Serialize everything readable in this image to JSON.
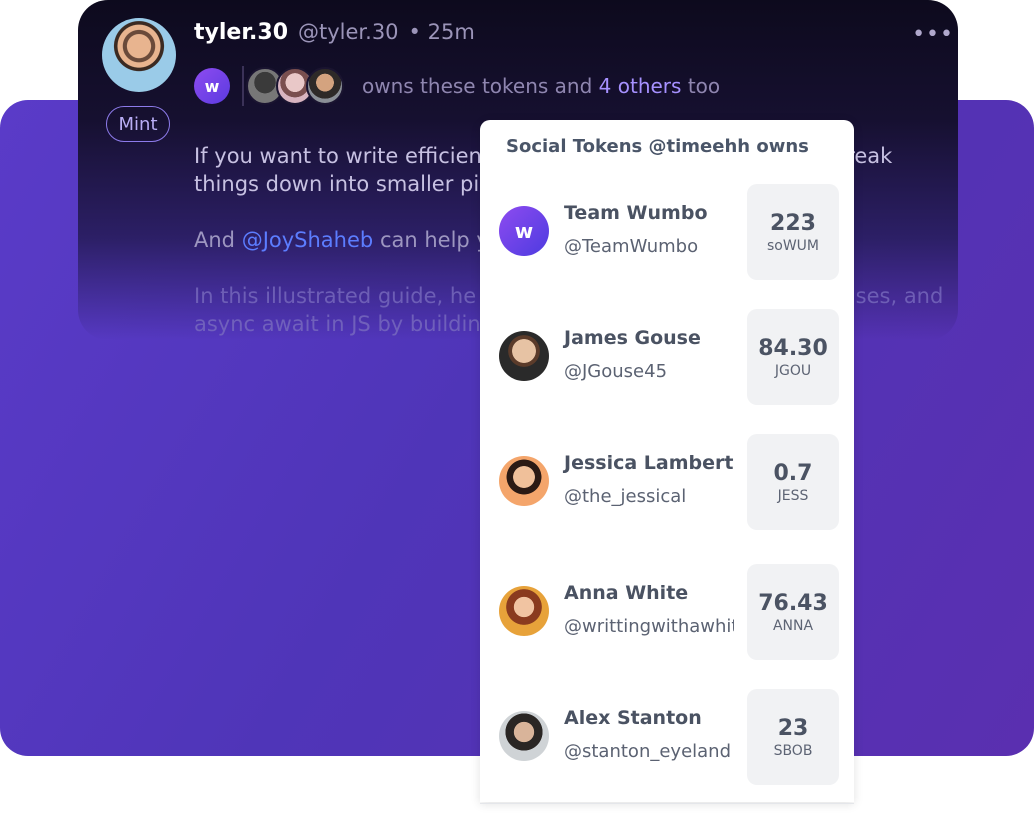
{
  "tweet": {
    "username": "tyler.30",
    "handle": "@tyler.30",
    "time": "• 25m",
    "more": "•••",
    "mint_label": "Mint",
    "logo_letter": "w",
    "owners_text_prefix": "owns these tokens and",
    "owners_others": "4 others",
    "owners_text_suffix": "too",
    "body_p1": "If you want to write efficient code, you need to know how to break things down into smaller pieces.",
    "body_p2_prefix": "And",
    "body_p2_mention": "@JoyShaheb",
    "body_p2_suffix": "can help you do just that.",
    "body_p3": "In this illustrated guide, he teaches you about callbacks, promises, and async await in JS by building an ice cream shop."
  },
  "panel": {
    "title": "Social Tokens @timeehh owns",
    "tokens": [
      {
        "name": "Team Wumbo",
        "handle": "@TeamWumbo",
        "amount": "223",
        "symbol": "soWUM"
      },
      {
        "name": "James Gouse",
        "handle": "@JGouse45",
        "amount": "84.30",
        "symbol": "JGOU"
      },
      {
        "name": "Jessica Lambert",
        "handle": "@the_jessical",
        "amount": "0.7",
        "symbol": "JESS"
      },
      {
        "name": "Anna White",
        "handle": "@writtingwithawhit",
        "amount": "76.43",
        "symbol": "ANNA"
      },
      {
        "name": "Alex Stanton",
        "handle": "@stanton_eyeland",
        "amount": "23",
        "symbol": "SBOB"
      }
    ]
  },
  "colors": {
    "accent": "#a691ff",
    "mention": "#5c7dff",
    "background_purple": "#5a3bc8"
  }
}
